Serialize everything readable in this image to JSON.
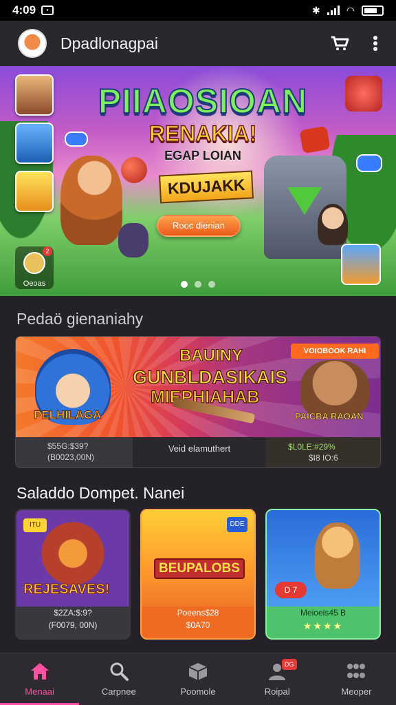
{
  "status": {
    "time": "4:09"
  },
  "app": {
    "title": "Dpadlonagpai"
  },
  "hero": {
    "title": "PIIAOSIOAN",
    "subtitle": "RENAKIA!",
    "small": "EGAP LOIAN",
    "badge": "KDUJAKK",
    "cta": "Rooc dienian",
    "corner_label": "Oeoas",
    "corner_badge": "2",
    "slides": 3,
    "active_slide": 1
  },
  "sections": {
    "featured_title": "Pedaö gienaniahy",
    "selected_title": "Saladdo Dompet. Nanei"
  },
  "promo": {
    "title1": "BAUINY",
    "title2": "GUNBLDASIKAIS",
    "title3": "MIEPHIAHAB",
    "char_label": "PELHILAGA",
    "tag": "VOIOBOOK RAHI",
    "monster_label": "PAICBA RAOAN",
    "footer_left_1": "$55G:$39?",
    "footer_left_2": "(B0023,00N)",
    "footer_mid": "Veid elamuthert",
    "footer_right_1": "$L0LE:#29%",
    "footer_right_2": "$I8 IO:6"
  },
  "cards": [
    {
      "title": "REJESAVES!",
      "tag": "ITU",
      "cap1": "$2ZA:$:9?",
      "cap2": "(F0079, 00N)"
    },
    {
      "title": "BEUPALOBS",
      "badge": "DDE",
      "cap1": "Poeens$28",
      "cap2": "$0A70"
    },
    {
      "pill": "D 7",
      "cap1": "Meioels45 B",
      "cap2": "★★★★"
    }
  ],
  "nav": [
    {
      "label": "Menaai",
      "icon": "home-icon"
    },
    {
      "label": "Carpnee",
      "icon": "search-icon"
    },
    {
      "label": "Poomole",
      "icon": "box-icon"
    },
    {
      "label": "Roipal",
      "icon": "people-icon",
      "badge": "DG"
    },
    {
      "label": "Meoper",
      "icon": "grid-icon"
    }
  ],
  "colors": {
    "accent": "#ff4fa3"
  }
}
